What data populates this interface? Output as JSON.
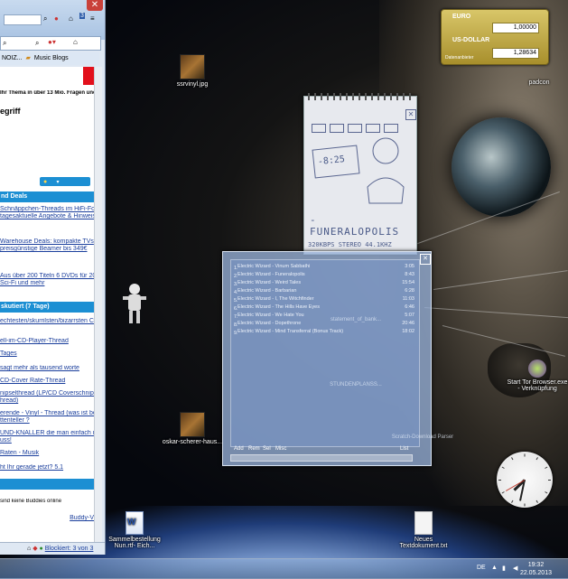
{
  "browser": {
    "tabs": [
      "NOIZ...",
      "Music Blogs"
    ],
    "heading_text": "Ihr Thema in über 13 Mio. Fragen und A",
    "title_fragment": "egriff",
    "sections": [
      {
        "title": "nd Deals",
        "items": [
          "Schnäppchen-Threads im HiFi-Fo",
          "tagesaktuelle Angebote & Hinweis",
          "Warehouse Deals: kompakte TVs",
          "preisgünstige Beamer bis 349€",
          "Aus über 200 Titeln 6 DVDs für 20",
          "Sci-Fi und mehr"
        ]
      },
      {
        "title": "skutiert (7 Tage)",
        "items": [
          "echtesten/skurrilsten/bizarrsten Cov",
          "ell-im-CD-Player-Thread",
          "Tages",
          "sagt mehr als tausend worte",
          "CD-Cover Rate-Thread",
          "nipselthread (LP/CD Coverschnipss",
          "hread)",
          "erende - Vinyl - Thread (was ist bei",
          "ttenteller ?",
          "UND-KNALLER die man einfach ma",
          "uss!",
          "Raten - Musik",
          "ht Ihr gerade jetzt? 5.1"
        ]
      }
    ],
    "buddies_text": "sind keine Buddies online",
    "buddy_link": "Buddy-V",
    "status_text": "Blockiert: 3 von 3"
  },
  "desktop_icons": [
    {
      "name": "ssrvinyl-icon",
      "label": "ssrvinyl.jpg"
    },
    {
      "name": "padcon-icon",
      "label": "padcon"
    },
    {
      "name": "oskar-icon",
      "label": "oskar-scherer-haus..."
    },
    {
      "name": "tor-icon",
      "label": "Start Tor Browser.exe - Verknüpfung"
    },
    {
      "name": "sammelbestellung-icon",
      "label": "Sammelbestellung Nun.rtf- Eich..."
    },
    {
      "name": "neues-textdokument-icon",
      "label": "Neues Textdokument.txt"
    }
  ],
  "currency": {
    "from_label": "EURO",
    "from_value": "1,00000",
    "to_label": "US-DOLLAR",
    "to_value": "1,28634",
    "footer": "Datenanbieter"
  },
  "album": {
    "display": "-8:25",
    "title": "- FUNERALOPOLIS",
    "subtitle": "320KBPS STEREO 44.1KHZ"
  },
  "playlist": {
    "tracks": [
      {
        "num": "1.",
        "name": "Electric Wizard - Vinum Sabbathi",
        "time": "3:05"
      },
      {
        "num": "2.",
        "name": "Electric Wizard - Funeralopolis",
        "time": "8:43"
      },
      {
        "num": "3.",
        "name": "Electric Wizard - Weird Tales",
        "time": "15:54"
      },
      {
        "num": "4.",
        "name": "Electric Wizard - Barbarian",
        "time": "6:28"
      },
      {
        "num": "5.",
        "name": "Electric Wizard - I, The Witchfinder",
        "time": "11:03"
      },
      {
        "num": "6.",
        "name": "Electric Wizard - The Hills Have Eyes",
        "time": "6:46"
      },
      {
        "num": "7.",
        "name": "Electric Wizard - We Hate You",
        "time": "5:07"
      },
      {
        "num": "8.",
        "name": "Electric Wizard - Dopethrone",
        "time": "20:46"
      },
      {
        "num": "9.",
        "name": "Electric Wizard - Mind Transferral (Bonus Track)",
        "time": "18:02"
      }
    ],
    "buttons": [
      "Add",
      "Rem",
      "Sel",
      "Misc"
    ],
    "list_button": "List",
    "ghost_labels": [
      "statement_of_bank...",
      "STUNDENPLANSS...",
      "Scratch-Download Parser"
    ]
  },
  "clock": {
    "hour": 7,
    "minute": 32
  },
  "taskbar": {
    "language": "DE",
    "time": "19:32",
    "date": "22.05.2013"
  },
  "colors": {
    "section_header": "#1c8fd3",
    "link": "#1a3e9c",
    "currency_gold": "#c2ab48",
    "playlist_blue": "#96afd7"
  }
}
